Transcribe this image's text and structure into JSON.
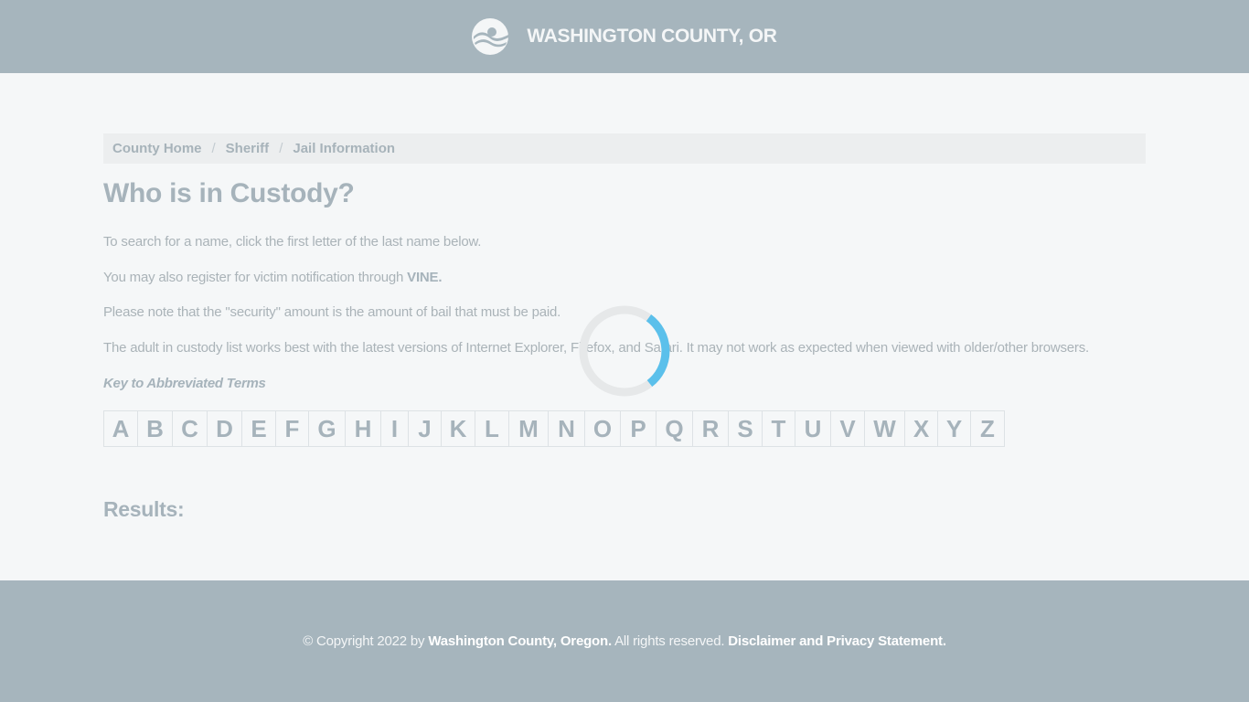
{
  "header": {
    "logo_icon": "washington-county-logo",
    "title": "WASHINGTON COUNTY, OR"
  },
  "breadcrumb": [
    {
      "label": "County Home"
    },
    {
      "label": "Sheriff"
    },
    {
      "label": "Jail Information"
    }
  ],
  "breadcrumb_separator": "/",
  "page_title": "Who is in Custody?",
  "paragraphs": {
    "p1": "To search for a name, click the first letter of the last name below.",
    "p2_prefix": "You may also register for victim notification through ",
    "p2_link": "VINE.",
    "p3": "Please note that the \"security\" amount is the amount of bail that must be paid.",
    "p4": "The adult in custody list works best with the latest versions of Internet Explorer, Firefox, and Safari. It may not work as expected when viewed with older/other browsers."
  },
  "key_link": "Key to Abbreviated Terms",
  "letters": [
    "A",
    "B",
    "C",
    "D",
    "E",
    "F",
    "G",
    "H",
    "I",
    "J",
    "K",
    "L",
    "M",
    "N",
    "O",
    "P",
    "Q",
    "R",
    "S",
    "T",
    "U",
    "V",
    "W",
    "X",
    "Y",
    "Z"
  ],
  "results_heading": "Results:",
  "loading": {
    "icon": "loading-spinner",
    "accent_color": "#5bc0eb",
    "track_color": "#e6e8e9"
  },
  "footer": {
    "prefix": "© Copyright 2022 by ",
    "org": "Washington County, Oregon.",
    "middle": " All rights reserved. ",
    "disclaimer": "Disclaimer and Privacy Statement."
  }
}
